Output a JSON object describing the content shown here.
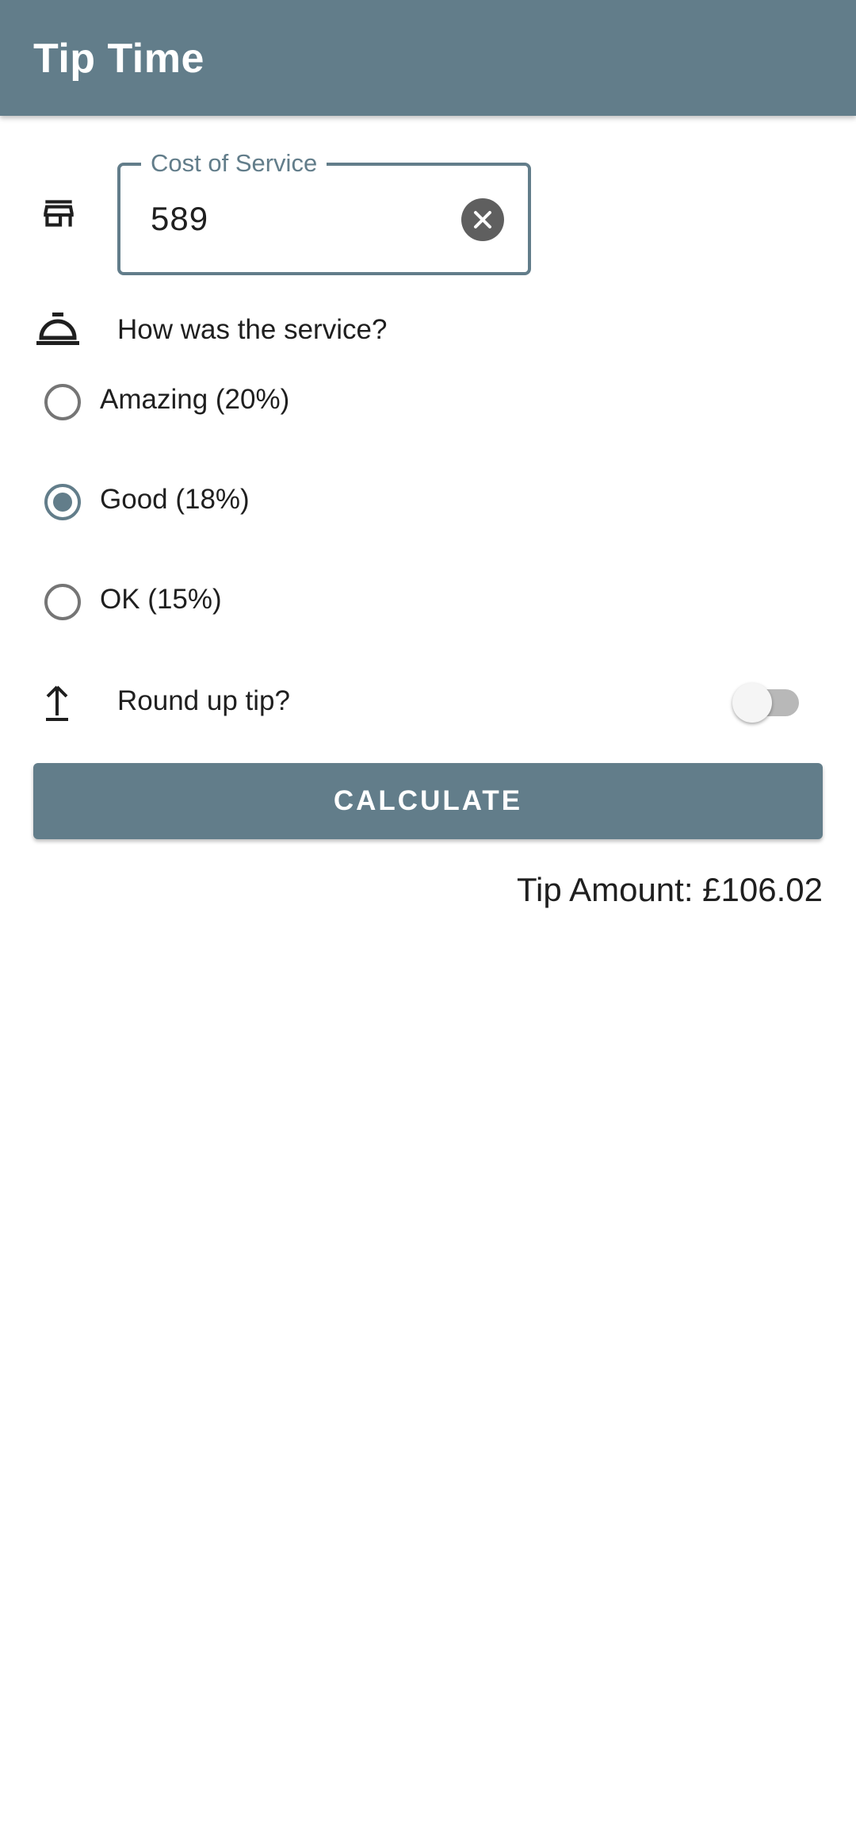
{
  "app": {
    "title": "Tip Time",
    "primary_color": "#627d8a"
  },
  "cost_field": {
    "label": "Cost of Service",
    "value": "589",
    "icon": "store-icon",
    "clear_icon": "clear-icon"
  },
  "service": {
    "question": "How was the service?",
    "icon": "room-service-bell-icon",
    "options": [
      {
        "label": "Amazing (20%)",
        "checked": false
      },
      {
        "label": "Good (18%)",
        "checked": true
      },
      {
        "label": "OK (15%)",
        "checked": false
      }
    ]
  },
  "round_up": {
    "label": "Round up tip?",
    "icon": "arrow-up-icon",
    "enabled": false
  },
  "calculate_button": {
    "label": "CALCULATE"
  },
  "result": {
    "text": "Tip Amount: £106.02"
  }
}
